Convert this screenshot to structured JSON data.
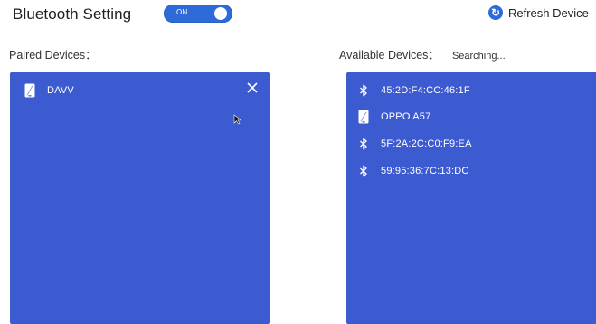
{
  "header": {
    "title": "Bluetooth Setting",
    "toggle_label": "ON",
    "refresh_label": "Refresh Device"
  },
  "paired": {
    "label": "Paired Devices：",
    "devices": [
      {
        "name": "DAVV",
        "icon": "phone-icon"
      }
    ]
  },
  "available": {
    "label": "Available Devices：",
    "status": "Searching...",
    "devices": [
      {
        "name": "45:2D:F4:CC:46:1F",
        "icon": "bluetooth-icon"
      },
      {
        "name": "OPPO A57",
        "icon": "phone-icon"
      },
      {
        "name": "5F:2A:2C:C0:F9:EA",
        "icon": "bluetooth-icon"
      },
      {
        "name": "59:95:36:7C:13:DC",
        "icon": "bluetooth-icon"
      }
    ]
  },
  "colors": {
    "accent": "#2f6bd8",
    "panel": "#3d5bd0",
    "panel_text": "#ffffff"
  }
}
